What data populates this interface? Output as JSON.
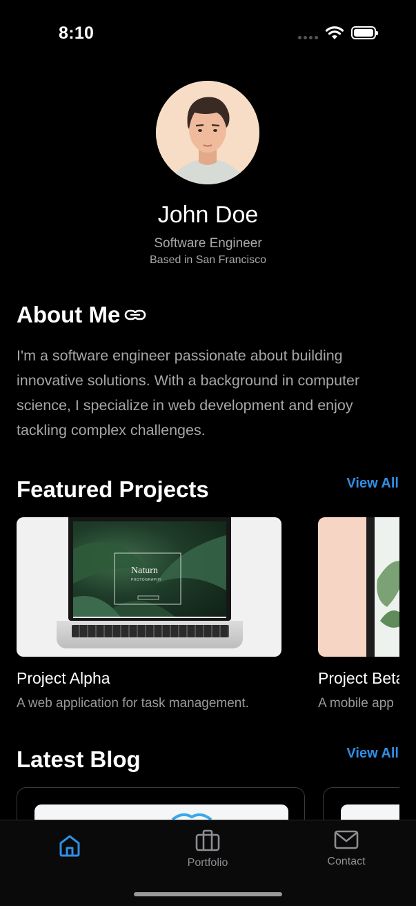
{
  "status": {
    "time": "8:10"
  },
  "profile": {
    "name": "John Doe",
    "role": "Software Engineer",
    "location": "Based in San Francisco"
  },
  "about": {
    "title": "About Me",
    "text": "I'm a software engineer passionate about building innovative solutions. With a background in computer science, I specialize in web development and enjoy tackling complex challenges."
  },
  "projects": {
    "title": "Featured Projects",
    "view_all": "View All",
    "items": [
      {
        "title": "Project Alpha",
        "description": "A web application for task management.",
        "image_text": "Naturn",
        "image_subtext": "PHOTOGRAPHY"
      },
      {
        "title": "Project Beta",
        "description": "A mobile app"
      }
    ]
  },
  "blog": {
    "title": "Latest Blog",
    "view_all": "View All"
  },
  "tabs": [
    {
      "label": "",
      "icon": "home-icon",
      "active": true
    },
    {
      "label": "Portfolio",
      "icon": "briefcase-icon",
      "active": false
    },
    {
      "label": "Contact",
      "icon": "envelope-icon",
      "active": false
    }
  ],
  "colors": {
    "accent": "#2f8fe6",
    "background": "#000000",
    "muted": "#a6a6a6"
  }
}
